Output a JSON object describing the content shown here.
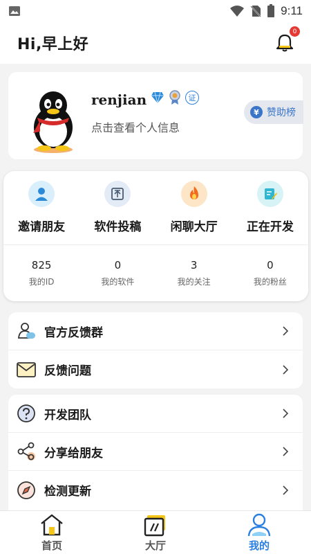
{
  "status_bar": {
    "time": "9:11"
  },
  "header": {
    "title": "Hi,早上好",
    "notification_count": "0"
  },
  "profile": {
    "username": "renjian",
    "subtitle": "点击查看个人信息",
    "sponsor_label": "赞助榜",
    "sponsor_coin": "¥",
    "cert_badge": "证"
  },
  "quick_actions": [
    {
      "label": "邀请朋友",
      "icon": "person-icon",
      "bg": "#d9effc"
    },
    {
      "label": "软件投稿",
      "icon": "upload-icon",
      "bg": "#e3ecf6"
    },
    {
      "label": "闲聊大厅",
      "icon": "fire-icon",
      "bg": "#fde6c8"
    },
    {
      "label": "正在开发",
      "icon": "edit-note-icon",
      "bg": "#d7f3f6"
    }
  ],
  "stats": [
    {
      "value": "825",
      "label": "我的ID"
    },
    {
      "value": "0",
      "label": "我的软件"
    },
    {
      "value": "3",
      "label": "我的关注"
    },
    {
      "value": "0",
      "label": "我的粉丝"
    }
  ],
  "menu_group_1": [
    {
      "label": "官方反馈群",
      "icon": "group-icon"
    },
    {
      "label": "反馈问题",
      "icon": "mail-icon"
    }
  ],
  "menu_group_2": [
    {
      "label": "开发团队",
      "icon": "question-icon"
    },
    {
      "label": "分享给朋友",
      "icon": "share-icon"
    },
    {
      "label": "检测更新",
      "icon": "compass-icon"
    }
  ],
  "bottom_nav": [
    {
      "label": "首页",
      "icon": "home-icon"
    },
    {
      "label": "大厅",
      "icon": "hall-icon"
    },
    {
      "label": "我的",
      "icon": "user-icon",
      "active": true
    }
  ],
  "colors": {
    "accent": "#2b7fe0",
    "badge": "#e53935"
  }
}
